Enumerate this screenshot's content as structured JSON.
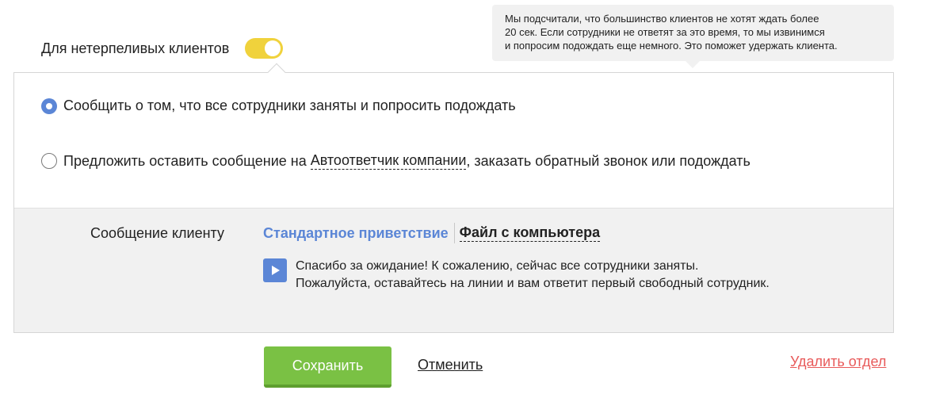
{
  "impatient": {
    "label": "Для нетерпеливых клиентов",
    "enabled": true,
    "accent_color": "#f0d23c"
  },
  "tooltip": {
    "line1": "Мы подсчитали, что большинство клиентов не хотят ждать более",
    "line2": "20 сек. Если сотрудники не ответят за это время, то мы извинимся",
    "line3": "и попросим подождать еще немного. Это поможет удержать клиента."
  },
  "options": {
    "option1": {
      "label": "Сообщить о том, что все сотрудники заняты и попросить подождать",
      "checked": true
    },
    "option2": {
      "label_before": "Предложить оставить сообщение на ",
      "link": "Автоответчик компании",
      "label_after": ", заказать обратный звонок или подождать",
      "checked": false
    }
  },
  "message": {
    "label": "Сообщение клиенту",
    "tabs": {
      "standard": "Стандартное приветствие",
      "file": "Файл с компьютера"
    },
    "player_icon": "play-icon",
    "text_line1": "Спасибо за ожидание! К сожалению, сейчас все сотрудники заняты.",
    "text_line2": "Пожалуйста, оставайтесь на линии и вам ответит первый свободный сотрудник."
  },
  "actions": {
    "save": "Сохранить",
    "cancel": "Отменить",
    "delete": "Удалить отдел"
  },
  "colors": {
    "accent_blue": "#5b86d6",
    "save_green": "#7ac144",
    "delete_red": "#e85a5a"
  }
}
